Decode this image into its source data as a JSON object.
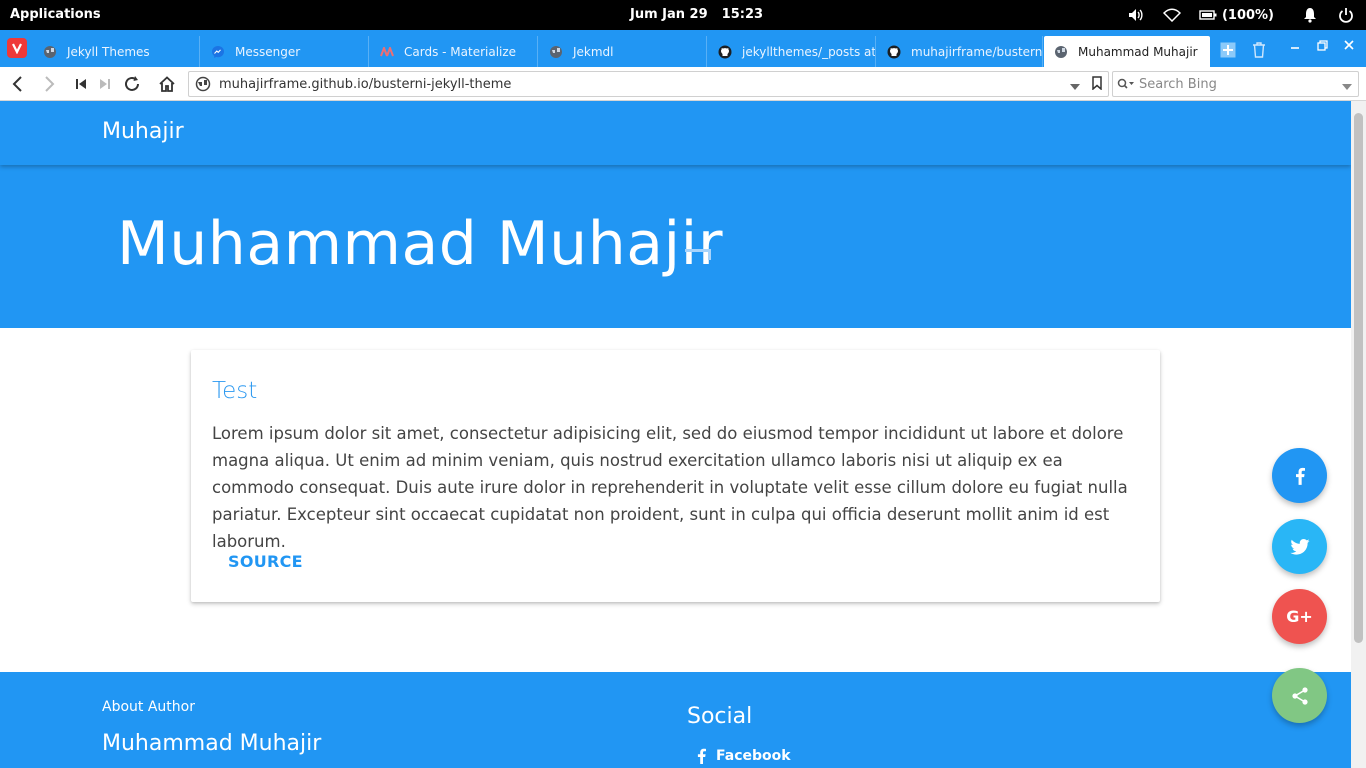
{
  "system": {
    "apps_label": "Applications",
    "date": "Jum Jan 29",
    "time": "15:23",
    "battery": "(100%)"
  },
  "tabs": [
    {
      "label": "Jekyll Themes",
      "icon": "globe-icon"
    },
    {
      "label": "Messenger",
      "icon": "messenger-icon"
    },
    {
      "label": "Cards - Materialize",
      "icon": "materialize-icon"
    },
    {
      "label": "Jekmdl",
      "icon": "globe-icon"
    },
    {
      "label": "jekyllthemes/_posts at m",
      "icon": "github-icon"
    },
    {
      "label": "muhajirframe/busterni-je",
      "icon": "github-icon"
    },
    {
      "label": "Muhammad Muhajir",
      "icon": "globe-icon",
      "active": true
    }
  ],
  "address": {
    "url": "muhajirframe.github.io/busterni-jekyll-theme",
    "search_placeholder": "Search Bing"
  },
  "page": {
    "brand": "Muhajir",
    "hero_title": "Muhammad Muhajir",
    "card": {
      "title": "Test",
      "body": "Lorem ipsum dolor sit amet, consectetur adipisicing elit, sed do eiusmod tempor incididunt ut labore et dolore magna aliqua. Ut enim ad minim veniam, quis nostrud exercitation ullamco laboris nisi ut aliquip ex ea commodo consequat. Duis aute irure dolor in reprehenderit in voluptate velit esse cillum dolore eu fugiat nulla pariatur. Excepteur sint occaecat cupidatat non proident, sunt in culpa qui officia deserunt mollit anim id est laborum.",
      "action": "SOURCE"
    },
    "footer": {
      "about_label": "About Author",
      "author_name": "Muhammad Muhajir",
      "social_heading": "Social",
      "facebook_link": "Facebook"
    },
    "fab": {
      "google_plus": "G+"
    }
  },
  "colors": {
    "primary": "#2196f3",
    "twitter": "#29b6f6",
    "google": "#ef5350",
    "share": "#81c784",
    "card_title": "#2b98f0"
  }
}
